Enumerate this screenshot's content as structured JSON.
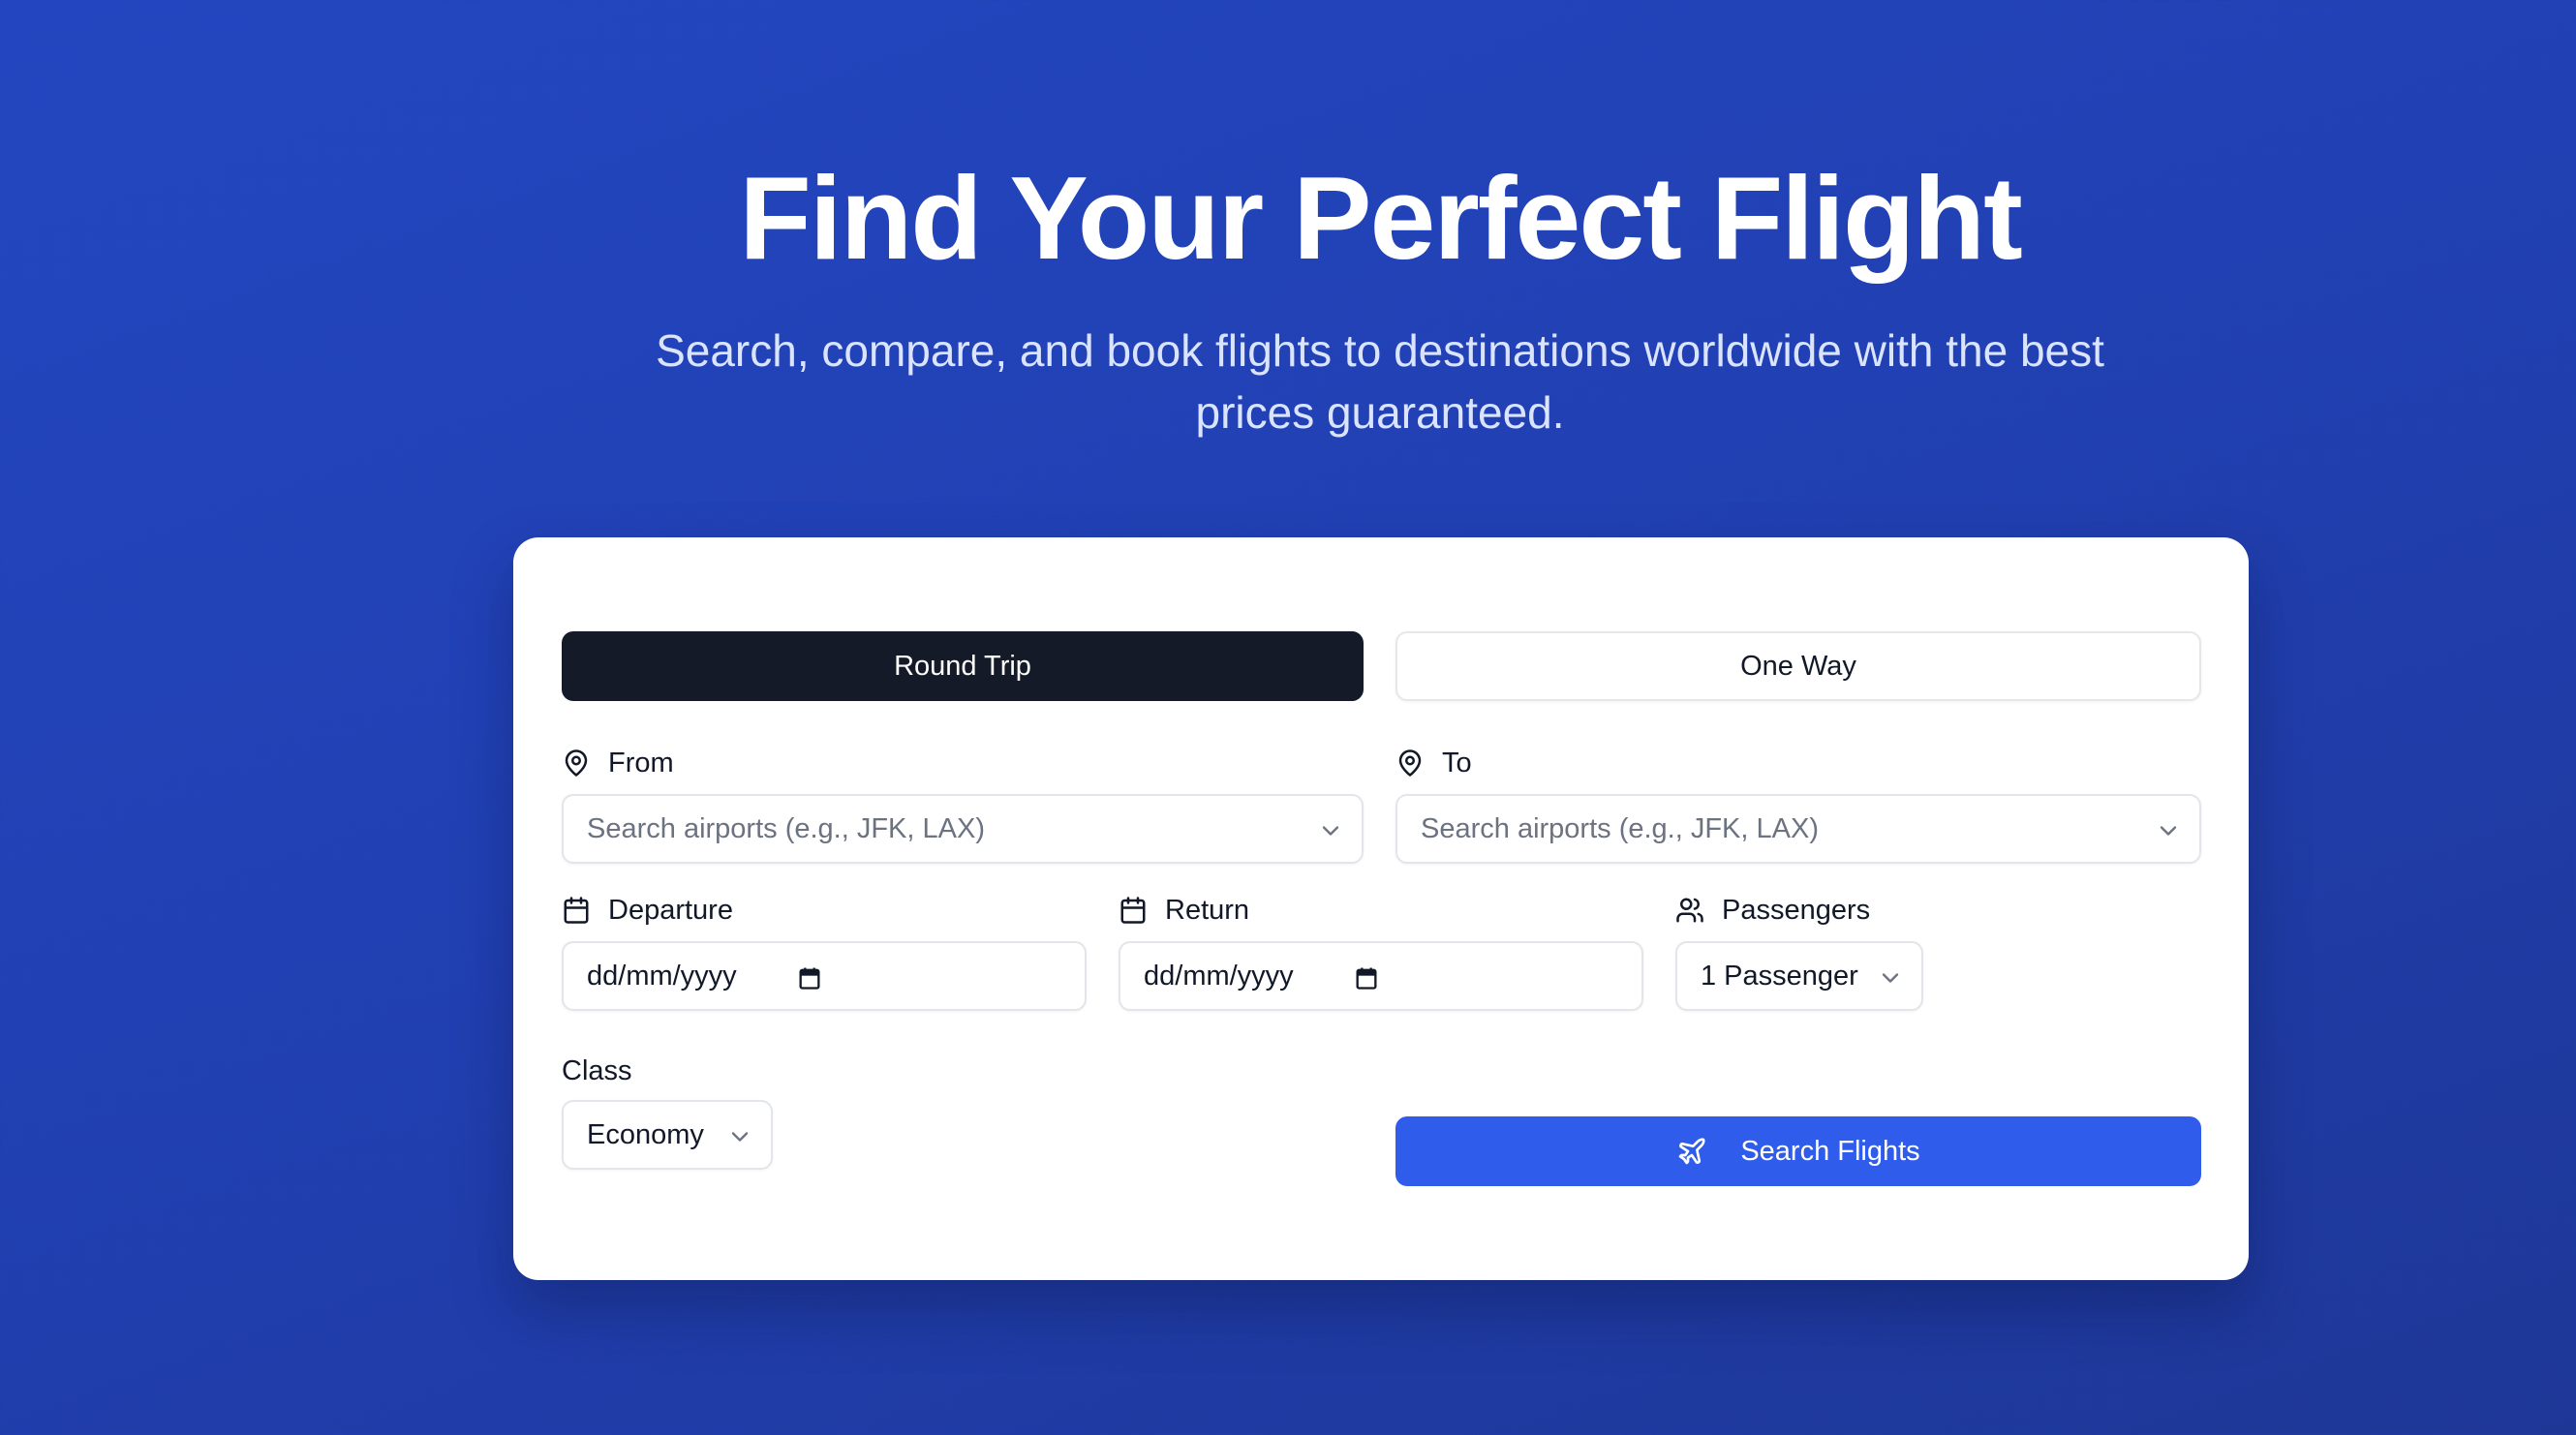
{
  "hero": {
    "title": "Find Your Perfect Flight",
    "subtitle": "Search, compare, and book flights to destinations worldwide with the best prices guaranteed."
  },
  "trip_type": {
    "round_trip_label": "Round Trip",
    "one_way_label": "One Way",
    "selected": "Round Trip"
  },
  "from": {
    "label": "From",
    "icon": "map-pin-icon",
    "placeholder": "Search airports (e.g., JFK, LAX)"
  },
  "to": {
    "label": "To",
    "icon": "map-pin-icon",
    "placeholder": "Search airports (e.g., JFK, LAX)"
  },
  "departure": {
    "label": "Departure",
    "icon": "calendar-icon",
    "value": "dd/mm/yyyy"
  },
  "return": {
    "label": "Return",
    "icon": "calendar-icon",
    "value": "dd/mm/yyyy"
  },
  "passengers": {
    "label": "Passengers",
    "icon": "users-icon",
    "value": "1 Passenger"
  },
  "class": {
    "label": "Class",
    "value": "Economy"
  },
  "search_button": {
    "label": "Search Flights",
    "icon": "plane-icon"
  },
  "colors": {
    "background_start": "#2346c0",
    "background_end": "#1e3797",
    "primary_button": "#2f5ceb",
    "active_tab": "#141a28"
  }
}
